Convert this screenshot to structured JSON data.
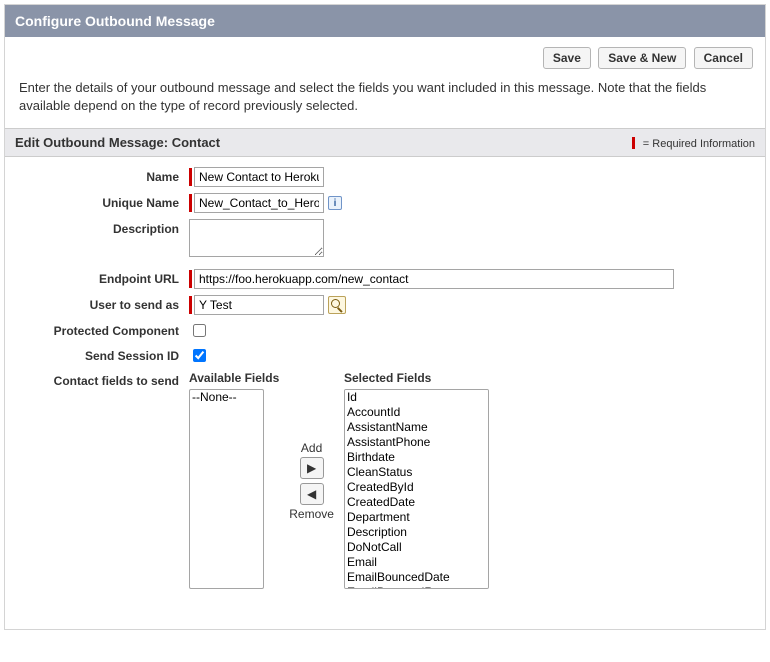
{
  "header": {
    "title": "Configure Outbound Message"
  },
  "buttons": {
    "save": "Save",
    "save_new": "Save & New",
    "cancel": "Cancel"
  },
  "intro": "Enter the details of your outbound message and select the fields you want included in this message. Note that the fields available depend on the type of record previously selected.",
  "section": {
    "title": "Edit Outbound Message: Contact",
    "required_info": "= Required Information"
  },
  "form": {
    "name": {
      "label": "Name",
      "value": "New Contact to Heroku",
      "required": true
    },
    "unique_name": {
      "label": "Unique Name",
      "value": "New_Contact_to_Heroku",
      "required": true
    },
    "description": {
      "label": "Description",
      "value": ""
    },
    "endpoint_url": {
      "label": "Endpoint URL",
      "value": "https://foo.herokuapp.com/new_contact",
      "required": true
    },
    "user_to_send_as": {
      "label": "User to send as",
      "value": "Y Test",
      "required": true
    },
    "protected_component": {
      "label": "Protected Component",
      "checked": false
    },
    "send_session_id": {
      "label": "Send Session ID",
      "checked": true
    },
    "contact_fields_to_send": {
      "label": "Contact fields to send"
    }
  },
  "transfer": {
    "available_header": "Available Fields",
    "selected_header": "Selected Fields",
    "add_label": "Add",
    "remove_label": "Remove",
    "available": [
      "--None--"
    ],
    "selected": [
      "Id",
      "AccountId",
      "AssistantName",
      "AssistantPhone",
      "Birthdate",
      "CleanStatus",
      "CreatedById",
      "CreatedDate",
      "Department",
      "Description",
      "DoNotCall",
      "Email",
      "EmailBouncedDate",
      "EmailBouncedReason"
    ]
  }
}
